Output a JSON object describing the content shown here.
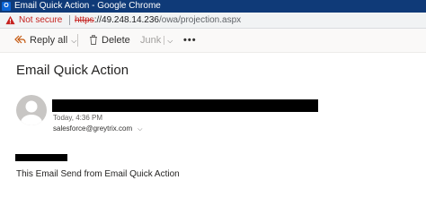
{
  "window": {
    "app_icon_text": "O",
    "title": "Email Quick Action - Google Chrome"
  },
  "address_bar": {
    "security_label": "Not secure",
    "url_scheme": "https",
    "url_host": "://49.248.14.236",
    "url_path": "/owa/projection.aspx"
  },
  "toolbar": {
    "reply_all_label": "Reply all",
    "delete_label": "Delete",
    "junk_label": "Junk",
    "more_label": "•••"
  },
  "message": {
    "subject": "Email Quick Action",
    "sent_time": "Today, 4:36 PM",
    "to_address": "salesforce@greytrix.com",
    "body": "This Email Send from Email Quick Action"
  },
  "colors": {
    "title_bar": "#0f3a78",
    "warning": "#c5221f",
    "redaction": "#000000"
  }
}
